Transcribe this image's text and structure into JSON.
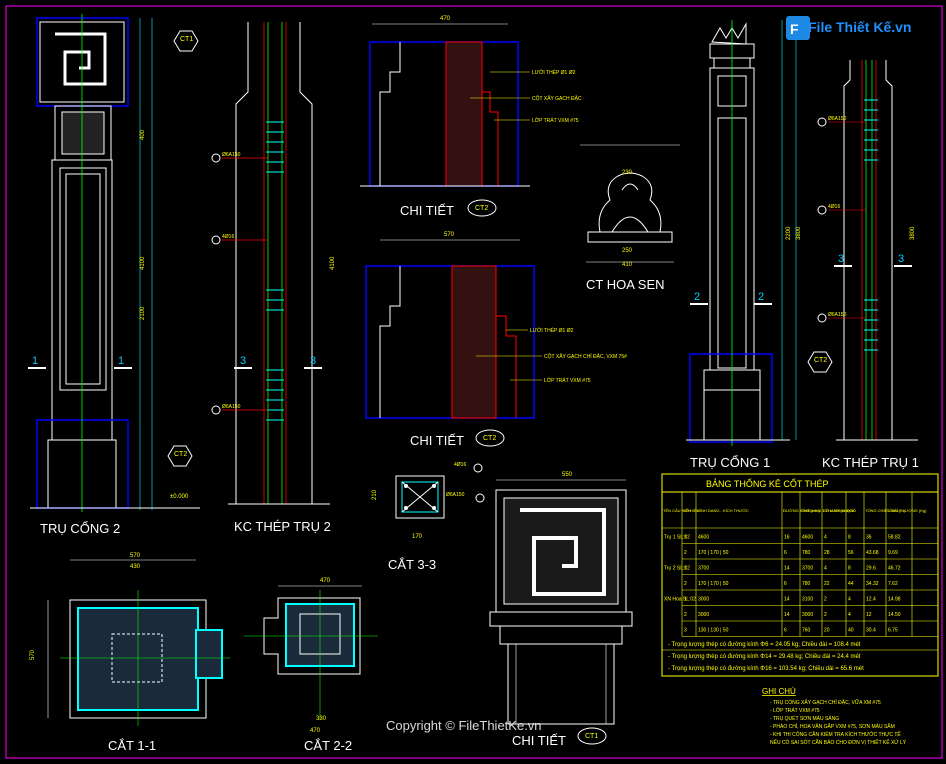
{
  "labels": {
    "tru_cong_2": "TRỤ CỔNG 2",
    "kc_thep_tru_2": "KC THÉP TRỤ 2",
    "tru_cong_1": "TRỤ CỔNG 1",
    "kc_thep_tru_1": "KC THÉP TRỤ 1",
    "chi_tiet": "CHI TIẾT",
    "ct_hoa_sen": "CT HOA SEN",
    "cat_1_1": "CẮT 1-1",
    "cat_2_2": "CẮT 2-2",
    "cat_3_3": "CẮT 3-3",
    "ct1": "CT1",
    "ct2": "CT2",
    "sec1": "1",
    "sec2": "2",
    "sec3": "3"
  },
  "notes": {
    "luoi_thep": "LƯỚI THÉP Ø1 Ø2",
    "cot_xay": "CỘT XÂY GẠCH ĐẶC",
    "lop_trat": "LỚP TRÁT VXM #75",
    "cot_xay_vxm": "CỘT XÂY GẠCH CHỈ ĐẶC, VXM 75#",
    "thep_a150": "Ø6A150",
    "thep_4d16": "4Ø16",
    "thep_a150b": "Ø6A150",
    "cote": "±0.000"
  },
  "dims": {
    "top_470": "470",
    "top_570": "570",
    "hoa_230": "230",
    "hoa_410": "410",
    "hoa_250": "250",
    "col_4100": "4100",
    "col_3800": "3800",
    "col_2100": "2100",
    "col_2200": "2200",
    "col_400": "400",
    "cat_570": "570",
    "cat_430": "430",
    "cat_470": "470",
    "cat_330": "330",
    "cat_550": "550",
    "cat_170": "170",
    "cat_210": "210"
  },
  "table": {
    "title": "BẢNG THỐNG KÊ CỐT THÉP",
    "headers": [
      "TÊN CẤU KIỆN",
      "SỐ HIỆU",
      "HÌNH DẠNG - KÍCH THƯỚC",
      "ĐƯỜNG KÍNH (mm)",
      "CHIỀU DÀI 1 THANH (mm)",
      "SỐ LƯỢNG 1 CK",
      "T.SỐ",
      "TỔNG CHIỀU DÀI (m)",
      "TỔNG T.LƯỢNG (Kg)"
    ],
    "rows": [
      [
        "Trụ 1 SL:02",
        "1",
        "4600",
        "16",
        "4600",
        "4",
        "8",
        "36",
        "58.82"
      ],
      [
        "",
        "2",
        "170 | 170 | 50",
        "6",
        "780",
        "28",
        "56",
        "43.68",
        "9.69"
      ],
      [
        "Trụ 2 SL:02",
        "1",
        "3700",
        "14",
        "3700",
        "4",
        "8",
        "29.6",
        "46.72"
      ],
      [
        "",
        "2",
        "170 | 170 | 50",
        "6",
        "780",
        "22",
        "44",
        "34.32",
        "7.62"
      ],
      [
        "XN Hoa SL:02",
        "1",
        "3000",
        "14",
        "3100",
        "2",
        "4",
        "12.4",
        "14.98"
      ],
      [
        "",
        "2",
        "3000",
        "14",
        "3000",
        "2",
        "4",
        "12",
        "14.50"
      ],
      [
        "",
        "3",
        "130 | 130 | 50",
        "6",
        "760",
        "20",
        "40",
        "30.4",
        "6.75"
      ]
    ],
    "totals": [
      "- Trọng lượng thép có đường kính Φ6 = 24.05 kg; Chiều dài = 108.4 mét",
      "- Trọng lượng thép có đường kính Φ14 = 29.48 kg; Chiều dài = 24.4 mét",
      "- Trọng lượng thép có đường kính Φ16 = 103.54 kg; Chiều dài = 65.6 mét"
    ]
  },
  "ghi_chu": {
    "title": "GHI CHÚ",
    "lines": [
      "- TRỤ CỔNG XÂY GẠCH CHỈ ĐẶC, VỮA XM #75",
      "- LỚP TRÁT VXM #75",
      "- TRỤ QUÉT SƠN MÀU SÁNG",
      "- PHÀO CHỈ, HOA VĂN GẮP VXM #75, SƠN MÀU SẪM",
      "- KHI THI CÔNG CẦN KIỂM TRA KÍCH THƯỚC THỰC TẾ",
      "NẾU CÓ SAI SÓT CẦN BÁO CHO ĐƠN VỊ THIẾT KẾ XỬ LÝ"
    ]
  },
  "logo": {
    "text": "File Thiết Kế.vn"
  },
  "copyright": "Copyright © FileThietKe.vn",
  "colors": {
    "background": "#000000",
    "frame": "#ff00ff",
    "outline": "#ffffff",
    "rebar": "#00ffff",
    "cut": "#0000ff",
    "dimension": "#ffff00",
    "hatch": "#ff0000",
    "axis": "#00ff00"
  }
}
